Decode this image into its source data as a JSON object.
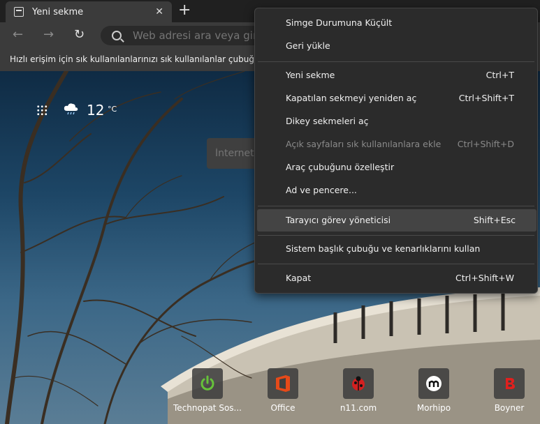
{
  "tab": {
    "title": "Yeni sekme",
    "close_glyph": "✕"
  },
  "new_tab_glyph": "+",
  "toolbar": {
    "back_glyph": "←",
    "forward_glyph": "→",
    "reload_glyph": "↻",
    "address_placeholder": "Web adresi ara veya gir"
  },
  "favbar": {
    "text": "Hızlı erişim için sık kullanılanlarınızı sık kullanılanlar çubuğunda"
  },
  "weather": {
    "temp": "12",
    "unit": "°C"
  },
  "page_search": {
    "placeholder": "İnternette"
  },
  "tiles": [
    {
      "label": "Technopat Sos...",
      "icon": "power-icon",
      "color": "#66c23a"
    },
    {
      "label": "Office",
      "icon": "office-icon",
      "color": "#e64a19"
    },
    {
      "label": "n11.com",
      "icon": "ladybug-icon",
      "color": "#d32020"
    },
    {
      "label": "Morhipo",
      "icon": "morhipo-icon",
      "color": "#111111"
    },
    {
      "label": "Boyner",
      "icon": "boyner-icon",
      "color": "#e0201e"
    }
  ],
  "menu": {
    "items": [
      {
        "label": "Simge Durumuna Küçült",
        "shortcut": ""
      },
      {
        "label": "Geri yükle",
        "shortcut": ""
      },
      {
        "label": "Yeni sekme",
        "shortcut": "Ctrl+T"
      },
      {
        "label": "Kapatılan sekmeyi yeniden aç",
        "shortcut": "Ctrl+Shift+T"
      },
      {
        "label": "Dikey sekmeleri aç",
        "shortcut": ""
      },
      {
        "label": "Açık sayfaları sık kullanılanlara ekle",
        "shortcut": "Ctrl+Shift+D",
        "disabled": true
      },
      {
        "label": "Araç çubuğunu özelleştir",
        "shortcut": ""
      },
      {
        "label": "Ad ve pencere...",
        "shortcut": ""
      },
      {
        "label": "Tarayıcı görev yöneticisi",
        "shortcut": "Shift+Esc",
        "hover": true
      },
      {
        "label": "Sistem başlık çubuğu ve kenarlıklarını kullan",
        "shortcut": ""
      },
      {
        "label": "Kapat",
        "shortcut": "Ctrl+Shift+W"
      }
    ]
  }
}
